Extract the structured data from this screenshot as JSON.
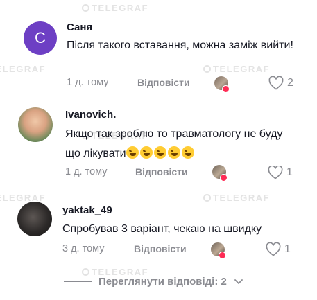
{
  "watermark": "TELEGRAF",
  "comments": [
    {
      "avatar_letter": "С",
      "avatar_color": "#6d3fc4",
      "username": "Саня",
      "text": "Після такого вставання, можна заміж вийти!",
      "time": "1 д. тому",
      "reply_label": "Відповісти",
      "likes": "2"
    },
    {
      "username": "Ivanovich.",
      "text": "Якщо так зроблю то травматологу не буду що лікувати",
      "emoji_count": 5,
      "emoji_name": "rolling-on-the-floor-laughing",
      "time": "1 д. тому",
      "reply_label": "Відповісти",
      "likes": "1"
    },
    {
      "username": "yaktak_49",
      "text": "Спробував 3 варіант, чекаю на швидку",
      "time": "3 д. тому",
      "reply_label": "Відповісти",
      "likes": "1"
    }
  ],
  "view_replies": {
    "label": "Переглянути відповіді: 2"
  },
  "colors": {
    "text": "#161823",
    "muted": "#8a8b91",
    "heart": "#fe2c55",
    "watermark": "#e3e3e3"
  },
  "icons": [
    "heart-outline-icon",
    "chevron-down-icon",
    "red-heart-badge-icon"
  ]
}
